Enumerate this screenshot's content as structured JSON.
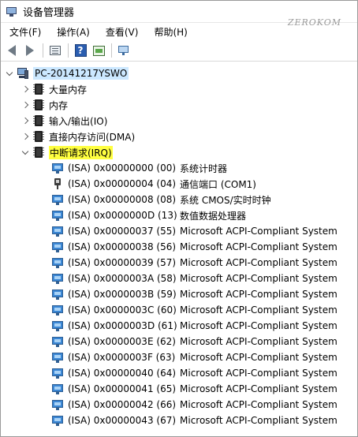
{
  "window": {
    "title": "设备管理器",
    "watermark": "ZEROKOM"
  },
  "menu": [
    {
      "id": "file",
      "label": "文件(F)"
    },
    {
      "id": "action",
      "label": "操作(A)"
    },
    {
      "id": "view",
      "label": "查看(V)"
    },
    {
      "id": "help",
      "label": "帮助(H)"
    }
  ],
  "toolbar": [
    {
      "name": "back-icon"
    },
    {
      "name": "forward-icon"
    },
    {
      "name": "properties-icon"
    },
    {
      "name": "help-icon"
    },
    {
      "name": "update-driver-icon"
    },
    {
      "name": "scan-hardware-icon"
    }
  ],
  "tree": {
    "root": {
      "label": "PC-20141217YSWO",
      "icon": "computer-icon"
    },
    "categories": [
      {
        "label": "大量内存",
        "icon": "chip-icon",
        "expanded": false
      },
      {
        "label": "内存",
        "icon": "chip-icon",
        "expanded": false
      },
      {
        "label": "输入/输出(IO)",
        "icon": "chip-icon",
        "expanded": false
      },
      {
        "label": "直接内存访问(DMA)",
        "icon": "chip-icon",
        "expanded": false
      },
      {
        "label": "中断请求(IRQ)",
        "icon": "chip-icon",
        "expanded": true,
        "highlight": "#ffff40"
      }
    ],
    "irq_entries": [
      {
        "irq": "(ISA) 0x00000000 (00)",
        "device": "系统计时器",
        "icon": "resource-icon"
      },
      {
        "irq": "(ISA) 0x00000004 (04)",
        "device": "通信端口 (COM1)",
        "icon": "port-icon"
      },
      {
        "irq": "(ISA) 0x00000008 (08)",
        "device": "系统 CMOS/实时时钟",
        "icon": "resource-icon"
      },
      {
        "irq": "(ISA) 0x0000000D (13)",
        "device": "数值数据处理器",
        "icon": "resource-icon"
      },
      {
        "irq": "(ISA) 0x00000037 (55)",
        "device": "Microsoft ACPI-Compliant System",
        "icon": "resource-icon"
      },
      {
        "irq": "(ISA) 0x00000038 (56)",
        "device": "Microsoft ACPI-Compliant System",
        "icon": "resource-icon"
      },
      {
        "irq": "(ISA) 0x00000039 (57)",
        "device": "Microsoft ACPI-Compliant System",
        "icon": "resource-icon"
      },
      {
        "irq": "(ISA) 0x0000003A (58)",
        "device": "Microsoft ACPI-Compliant System",
        "icon": "resource-icon"
      },
      {
        "irq": "(ISA) 0x0000003B (59)",
        "device": "Microsoft ACPI-Compliant System",
        "icon": "resource-icon"
      },
      {
        "irq": "(ISA) 0x0000003C (60)",
        "device": "Microsoft ACPI-Compliant System",
        "icon": "resource-icon"
      },
      {
        "irq": "(ISA) 0x0000003D (61)",
        "device": "Microsoft ACPI-Compliant System",
        "icon": "resource-icon"
      },
      {
        "irq": "(ISA) 0x0000003E (62)",
        "device": "Microsoft ACPI-Compliant System",
        "icon": "resource-icon"
      },
      {
        "irq": "(ISA) 0x0000003F (63)",
        "device": "Microsoft ACPI-Compliant System",
        "icon": "resource-icon"
      },
      {
        "irq": "(ISA) 0x00000040 (64)",
        "device": "Microsoft ACPI-Compliant System",
        "icon": "resource-icon"
      },
      {
        "irq": "(ISA) 0x00000041 (65)",
        "device": "Microsoft ACPI-Compliant System",
        "icon": "resource-icon"
      },
      {
        "irq": "(ISA) 0x00000042 (66)",
        "device": "Microsoft ACPI-Compliant System",
        "icon": "resource-icon"
      },
      {
        "irq": "(ISA) 0x00000043 (67)",
        "device": "Microsoft ACPI-Compliant System",
        "icon": "resource-icon"
      }
    ]
  }
}
